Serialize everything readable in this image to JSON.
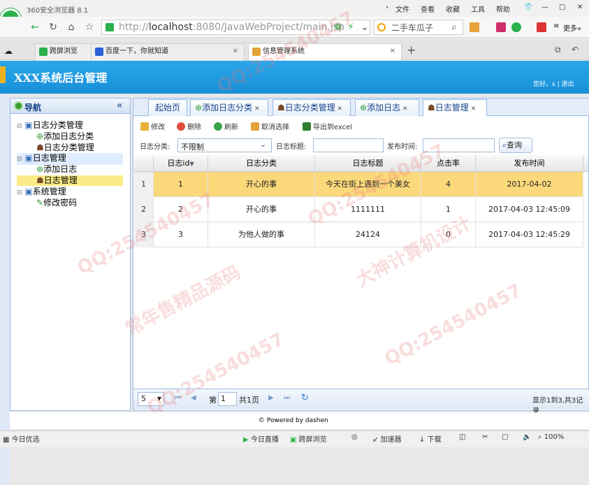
{
  "browser": {
    "name": "360安全浏览器 8.1",
    "logo_letter": "e",
    "menu": [
      "文件",
      "查看",
      "收藏",
      "工具",
      "帮助"
    ],
    "url_host": "localhost",
    "url_rest": ":8080/JavaWebProject/main.jsp",
    "url_prefix": "http://",
    "search_text": "二手车瓜子",
    "more_label": "更多»",
    "tabs": [
      {
        "label": "跨屏浏览",
        "active": false
      },
      {
        "label": "百度一下，你就知道",
        "active": false
      },
      {
        "label": "信息管理系统",
        "active": true
      }
    ]
  },
  "app": {
    "title": "XXX系统后台管理",
    "user_greeting": "您好，s",
    "logout_label": "退出"
  },
  "nav": {
    "title": "导航",
    "tree": [
      {
        "label": "日志分类管理",
        "level": 0,
        "icon": "computer-icon"
      },
      {
        "label": "添加日志分类",
        "level": 1,
        "icon": "add-icon"
      },
      {
        "label": "日志分类管理",
        "level": 1,
        "icon": "user-icon"
      },
      {
        "label": "日志管理",
        "level": 0,
        "icon": "computer-icon"
      },
      {
        "label": "添加日志",
        "level": 1,
        "icon": "add-icon"
      },
      {
        "label": "日志管理",
        "level": 1,
        "icon": "user-icon"
      },
      {
        "label": "系统管理",
        "level": 0,
        "icon": "computer-icon"
      },
      {
        "label": "修改密码",
        "level": 1,
        "icon": "pencil-icon"
      }
    ]
  },
  "main_tabs": [
    {
      "label": "起始页"
    },
    {
      "label": "添加日志分类"
    },
    {
      "label": "日志分类管理"
    },
    {
      "label": "添加日志"
    },
    {
      "label": "日志管理"
    }
  ],
  "toolbar": {
    "edit": "修改",
    "delete": "删除",
    "refresh": "刷新",
    "unselect": "取消选择",
    "export": "导出到excel"
  },
  "filter": {
    "category_label": "日志分类:",
    "category_value": "不限制",
    "title_label": "日志标题:",
    "title_value": "",
    "date_label": "发布时间:",
    "date_value": "",
    "query_label": "查询"
  },
  "grid": {
    "columns": [
      "日志id",
      "日志分类",
      "日志标题",
      "点击率",
      "发布时间"
    ],
    "rows": [
      {
        "rownum": "1",
        "id": "1",
        "category": "开心的事",
        "title": "今天在街上遇到一个美女",
        "hits": "4",
        "date": "2017-04-02"
      },
      {
        "rownum": "2",
        "id": "2",
        "category": "开心的事",
        "title": "1111111",
        "hits": "1",
        "date": "2017-04-03 12:45:09"
      },
      {
        "rownum": "3",
        "id": "3",
        "category": "为他人做的事",
        "title": "24124",
        "hits": "0",
        "date": "2017-04-03 12:45:29"
      }
    ]
  },
  "pager": {
    "page_size": "5",
    "page_prefix": "第",
    "page_value": "1",
    "page_suffix": "共1页",
    "summary": "显示1到3,共3记录"
  },
  "footer": {
    "powered": "© Powered by dashen"
  },
  "statusbar": {
    "left": "今日优选",
    "live": "今日直播",
    "cross": "跨屏浏览",
    "accel": "加速器",
    "download": "下载",
    "zoom": "100%"
  }
}
